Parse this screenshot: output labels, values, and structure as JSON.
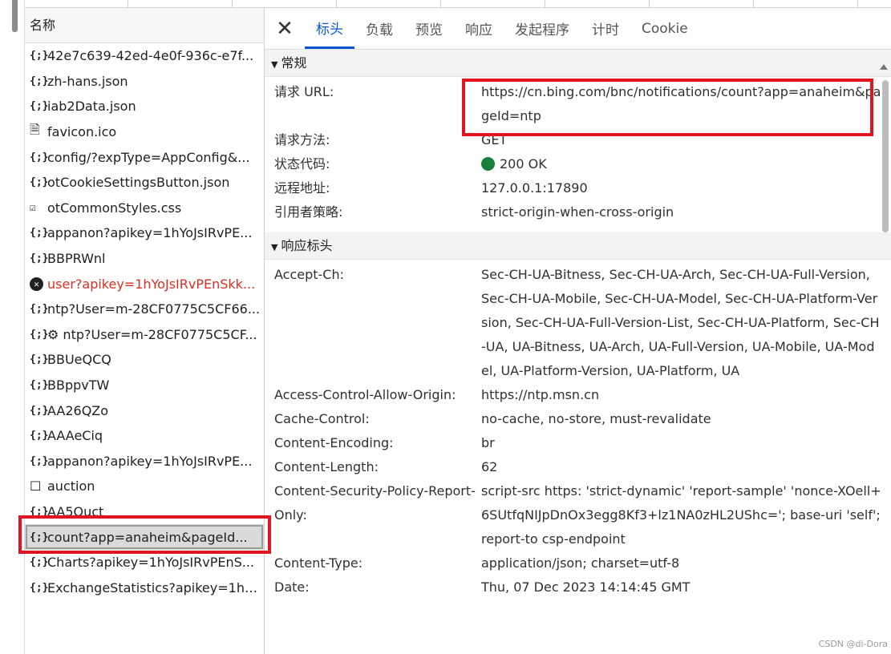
{
  "request_list": {
    "header": "名称",
    "rows": [
      {
        "icon": "{;}",
        "name": "42e7c639-42ed-4e0f-936c-e7f..."
      },
      {
        "icon": "{;}",
        "name": "zh-hans.json"
      },
      {
        "icon": "{;}",
        "name": "iab2Data.json"
      },
      {
        "icon": "🗎",
        "name": "favicon.ico"
      },
      {
        "icon": "{;}",
        "name": "config/?expType=AppConfig&..."
      },
      {
        "icon": "{;}",
        "name": "otCookieSettingsButton.json"
      },
      {
        "icon": "☑",
        "name": "otCommonStyles.css"
      },
      {
        "icon": "{;}",
        "name": "appanon?apikey=1hYoJsIRvPE..."
      },
      {
        "icon": "{;}",
        "name": "BBPRWnl"
      },
      {
        "icon": "✕",
        "name": "user?apikey=1hYoJsIRvPEnSkk..."
      },
      {
        "icon": "{;}",
        "name": "ntp?User=m-28CF0775C5CF66..."
      },
      {
        "icon": "{;}",
        "name": "⚙ ntp?User=m-28CF0775C5CF..."
      },
      {
        "icon": "{;}",
        "name": "BBUeQCQ"
      },
      {
        "icon": "{;}",
        "name": "BBppvTW"
      },
      {
        "icon": "{;}",
        "name": "AA26QZo"
      },
      {
        "icon": "{;}",
        "name": "AAAeCiq"
      },
      {
        "icon": "{;}",
        "name": "appanon?apikey=1hYoJsIRvPE..."
      },
      {
        "icon": "☐",
        "name": "auction"
      },
      {
        "icon": "{;}",
        "name": "AA5Quct"
      },
      {
        "icon": "{;}",
        "name": "count?app=anaheim&pageId..."
      },
      {
        "icon": "{;}",
        "name": "Charts?apikey=1hYoJsIRvPEnS..."
      },
      {
        "icon": "{;}",
        "name": "ExchangeStatistics?apikey=1hY..."
      }
    ]
  },
  "tabs": [
    "标头",
    "负载",
    "预览",
    "响应",
    "发起程序",
    "计时",
    "Cookie"
  ],
  "general": {
    "title": "常规",
    "url_label": "请求 URL:",
    "url_value": "https://cn.bing.com/bnc/notifications/count?app=anaheim&pageId=ntp",
    "method_label": "请求方法:",
    "method_value": "GET",
    "status_label": "状态代码:",
    "status_value": "200 OK",
    "remote_label": "远程地址:",
    "remote_value": "127.0.0.1:17890",
    "referrer_label": "引用者策略:",
    "referrer_value": "strict-origin-when-cross-origin"
  },
  "response_headers": {
    "title": "响应标头",
    "items": [
      {
        "key": "Accept-Ch:",
        "value": "Sec-CH-UA-Bitness, Sec-CH-UA-Arch, Sec-CH-UA-Full-Version, Sec-CH-UA-Mobile, Sec-CH-UA-Model, Sec-CH-UA-Platform-Version, Sec-CH-UA-Full-Version-List, Sec-CH-UA-Platform, Sec-CH-UA, UA-Bitness, UA-Arch, UA-Full-Version, UA-Mobile, UA-Model, UA-Platform-Version, UA-Platform, UA"
      },
      {
        "key": "Access-Control-Allow-Origin:",
        "value": "https://ntp.msn.cn"
      },
      {
        "key": "Cache-Control:",
        "value": "no-cache, no-store, must-revalidate"
      },
      {
        "key": "Content-Encoding:",
        "value": "br"
      },
      {
        "key": "Content-Length:",
        "value": "62"
      },
      {
        "key": "Content-Security-Policy-Report-Only:",
        "value": "script-src https: 'strict-dynamic' 'report-sample' 'nonce-XOell+6SUtfqNIJpDnOx3egg8Kf3+lz1NA0zHL2UShc='; base-uri 'self';report-to csp-endpoint"
      },
      {
        "key": "Content-Type:",
        "value": "application/json; charset=utf-8"
      },
      {
        "key": "Date:",
        "value": "Thu, 07 Dec 2023 14:14:45 GMT"
      }
    ]
  },
  "watermark": "CSDN @di-Dora",
  "colors": {
    "accent": "#0b57d0",
    "highlight": "#e3141f",
    "status_ok": "#188038",
    "error_text": "#d93025"
  }
}
